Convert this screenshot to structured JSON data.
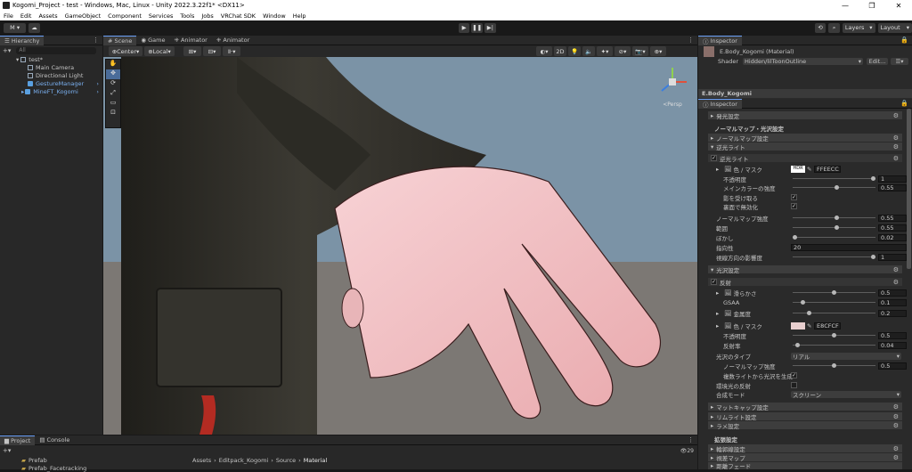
{
  "window": {
    "title": "Kogomi_Project - test - Windows, Mac, Linux - Unity 2022.3.22f1* <DX11>"
  },
  "menu": [
    "File",
    "Edit",
    "Assets",
    "GameObject",
    "Component",
    "Services",
    "Tools",
    "Jobs",
    "VRChat SDK",
    "Window",
    "Help"
  ],
  "toolbar": {
    "account": "M ▾",
    "layers": "Layers",
    "layout": "Layout"
  },
  "hierarchy": {
    "tab": "Hierarchy",
    "search_placeholder": "All",
    "items": [
      {
        "label": "test*"
      },
      {
        "label": "Main Camera"
      },
      {
        "label": "Directional Light"
      },
      {
        "label": "GestureManager"
      },
      {
        "label": "MineFT_Kogomi"
      }
    ]
  },
  "scene": {
    "tabs": [
      "Scene",
      "Game",
      "Animator",
      "Animator"
    ],
    "pivot": "Center",
    "space": "Local",
    "mode_2d": "2D",
    "gizmo_label": "<Persp"
  },
  "inspector": {
    "tab": "Inspector",
    "material_name": "E.Body_Kogomi (Material)",
    "shader_label": "Shader",
    "shader_value": "Hidden/lilToonOutline",
    "edit_button": "Edit...",
    "object_name": "E.Body_Kogomi",
    "tab2": "Inspector",
    "rows": {
      "emission": "発光設定",
      "normal_header": "ノーマルマップ・光沢設定",
      "normal_settings": "ノーマルマップ設定",
      "backlight": "逆光ライト",
      "backlight_toggle": "逆光ライト",
      "color_mask": "色 / マスク",
      "hdr": "HDR",
      "bl_color": "FFEECC",
      "opacity": "不透明度",
      "opacity_val": "1",
      "main_color_strength": "メインカラーの強度",
      "mcs_val": "0.55",
      "receive_shadow": "影を受け取る",
      "backface_disable": "裏面で無効化",
      "normal_strength": "ノーマルマップ強度",
      "ns_val": "0.55",
      "range": "範囲",
      "range_val": "0.55",
      "blur": "ぼかし",
      "blur_val": "0.02",
      "directivity": "指向性",
      "dir_val": "20",
      "view_dir": "視線方向の影響度",
      "vd_val": "1",
      "gloss_settings": "光沢設定",
      "reflection": "反射",
      "smoothness": "滑らかさ",
      "smooth_val": "0.5",
      "gsaa": "GSAA",
      "gsaa_val": "0.1",
      "metallic": "金属度",
      "metal_val": "0.2",
      "color_mask2": "色 / マスク",
      "refl_color": "E8CFCF",
      "opacity2": "不透明度",
      "op2_val": "0.5",
      "reflectance": "反射率",
      "refl_val": "0.04",
      "gloss_type": "光沢のタイプ",
      "gloss_type_val": "リアル",
      "normal_strength2": "ノーマルマップ強度",
      "ns2_val": "0.5",
      "multi_light": "複数ライトから光沢を生成",
      "env_reflection": "環境光の反射",
      "blend_mode": "合成モード",
      "blend_val": "スクリーン",
      "matcap": "マットキャップ設定",
      "rimlight": "リムライト設定",
      "fur": "ラメ設定",
      "extended": "拡張設定",
      "outline": "輪郭線設定",
      "parallax": "視差マップ",
      "distance_fade": "距離フェード"
    }
  },
  "bottom": {
    "tabs": [
      "Project",
      "Console"
    ],
    "breadcrumb": [
      "Assets",
      "Editpack_Kogomi",
      "Source",
      "Material"
    ],
    "folders": [
      "Prefab",
      "Prefab_Facetracking"
    ],
    "count": "29"
  },
  "colors": {
    "accent": "#6a9ff7",
    "panel": "#282828",
    "bg": "#191919"
  }
}
